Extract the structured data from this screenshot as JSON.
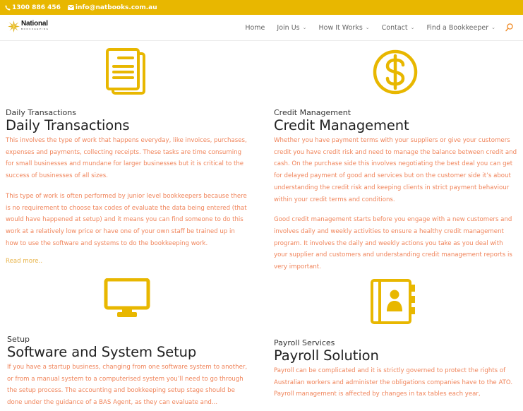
{
  "topbar": {
    "phone": "1300 886 456",
    "email": "info@natbooks.com.au",
    "phone_icon": "phone-icon",
    "email_icon": "envelope-icon",
    "bg_color": "#e8b700"
  },
  "header": {
    "logo": {
      "name": "National",
      "sub": "BOOKKEEPING",
      "icon": "star-icon"
    },
    "nav": [
      {
        "label": "Home",
        "has_dropdown": false
      },
      {
        "label": "Join Us",
        "has_dropdown": true
      },
      {
        "label": "How It Works",
        "has_dropdown": true
      },
      {
        "label": "Contact",
        "has_dropdown": true
      },
      {
        "label": "Find a Bookkeeper",
        "has_dropdown": true
      }
    ],
    "chevron": "⌄",
    "search_icon": "search-icon"
  },
  "colors": {
    "accent": "#e8b700",
    "body_text": "#f0845a",
    "link": "#e8b44a",
    "heading": "#222222"
  },
  "cards": [
    {
      "icon": "documents-icon",
      "subtitle": "Daily Transactions",
      "title": "Daily Transactions",
      "paragraphs": [
        "This involves the type of work that happens everyday, like invoices, purchases, expenses and payments, collecting receipts. These tasks are time consuming for small businesses and mundane for larger businesses but it is critical to the success of businesses of all sizes.",
        "This type of work is often performed by junior level bookkeepers because there is no requirement to choose tax codes of evaluate the data being entered (that would have happened at setup) and it means you can find someone to do this work at a relatively low price or have one of your own staff be trained up in how to use the software and systems to do the bookkeeping work."
      ],
      "read_more": "Read more.."
    },
    {
      "icon": "dollar-coin-icon",
      "subtitle": "Credit Management",
      "title": "Credit Management",
      "paragraphs": [
        "Whether you have payment terms with your suppliers or give your customers credit you have credit risk and need to manage the balance between credit and cash. On the purchase side this involves negotiating the best deal you can get for delayed payment of good and services but on the customer side it’s about understanding the credit risk and keeping clients in strict payment behaviour within your credit terms and conditions.",
        "Good credit management starts before you engage with a new customers and involves daily and weekly activities to ensure a healthy credit management program. It involves the daily and weekly actions you take as you deal with your supplier and customers and understanding credit management reports is very important."
      ]
    },
    {
      "icon": "monitor-icon",
      "subtitle": "Setup",
      "title": "Software and System Setup",
      "paragraphs": [
        "If you have a startup business, changing from one software system to another, or from a manual system to a computerised system you’ll need to go through the setup process. The accounting and bookkeeping setup stage should be done under the guidance of a BAS Agent, as they can evaluate and..."
      ]
    },
    {
      "icon": "contact-book-icon",
      "subtitle": "Payroll Services",
      "title": "Payroll Solution",
      "paragraphs": [
        "Payroll can be complicated and it is strictly governed to protect the rights of Australian workers and administer the obligations companies have to the ATO. Payroll management is affected by changes in tax tables each year,"
      ]
    }
  ]
}
